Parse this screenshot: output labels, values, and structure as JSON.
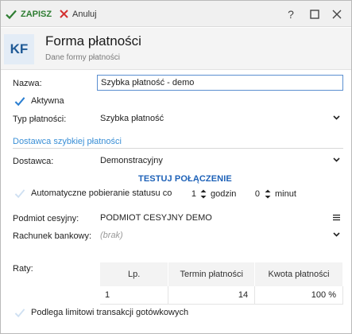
{
  "toolbar": {
    "save_label": "ZAPISZ",
    "cancel_label": "Anuluj",
    "help_label": "?"
  },
  "header": {
    "logo_text": "KF",
    "title": "Forma płatności",
    "subtitle": "Dane formy płatności"
  },
  "form": {
    "name_label": "Nazwa:",
    "name_value": "Szybka płatność - demo",
    "active_label": "Aktywna",
    "active_checked": true,
    "type_label": "Typ płatności:",
    "type_value": "Szybka płatność",
    "provider_section": "Dostawca szybkiej płatności",
    "provider_label": "Dostawca:",
    "provider_value": "Demonstracyjny",
    "test_connection": "TESTUJ POŁĄCZENIE",
    "auto_status_label": "Automatyczne pobieranie statusu co",
    "auto_hours_value": "1",
    "hours_label": "godzin",
    "auto_minutes_value": "0",
    "minutes_label": "minut",
    "assignee_label": "Podmiot cesyjny:",
    "assignee_value": "PODMIOT CESYJNY DEMO",
    "bank_label": "Rachunek bankowy:",
    "bank_placeholder": "(brak)",
    "installments_label": "Raty:",
    "cash_limit_label": "Podlega limitowi transakcji gotówkowych"
  },
  "installments": {
    "columns": [
      "Lp.",
      "Termin płatności",
      "Kwota płatności"
    ],
    "rows": [
      {
        "lp": "1",
        "term": "14",
        "amount": "100 %"
      }
    ]
  },
  "colors": {
    "accent": "#3a8fd6",
    "save_green": "#2e7d32",
    "cancel_red": "#d32f2f",
    "field_border": "#5b8fd0"
  }
}
